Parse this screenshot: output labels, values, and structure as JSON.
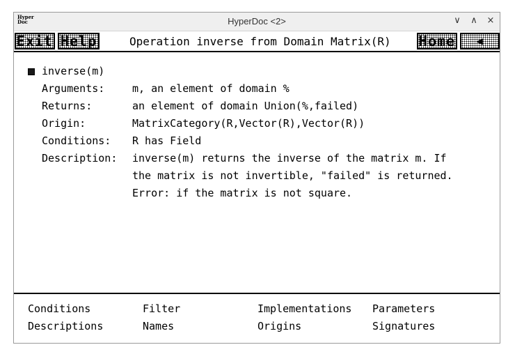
{
  "window": {
    "title": "HyperDoc <2>",
    "logo_line1": "Hyper",
    "logo_line2": "Doc",
    "controls": {
      "minimize": "∨",
      "maximize": "∧",
      "close": "×"
    }
  },
  "toolbar": {
    "exit_label": "Exit",
    "help_label": "Help",
    "page_title": "Operation inverse from Domain Matrix(R)",
    "home_label": "Home",
    "back_label": "◀"
  },
  "operation": {
    "signature": "inverse(m)",
    "fields": [
      {
        "label": "Arguments:",
        "value": "m, an element of domain %"
      },
      {
        "label": "Returns:",
        "value": "an element of domain Union(%,failed)"
      },
      {
        "label": "Origin:",
        "value": "MatrixCategory(R,Vector(R),Vector(R))"
      },
      {
        "label": "Conditions:",
        "value": "R has Field"
      },
      {
        "label": "Description:",
        "value": "inverse(m) returns the inverse of the matrix m. If"
      }
    ],
    "description_cont": [
      "the matrix is not invertible, \"failed\" is returned.",
      "Error: if the matrix is not square."
    ]
  },
  "nav_links": {
    "conditions": "Conditions",
    "filter": "Filter",
    "implementations": "Implementations",
    "parameters": "Parameters",
    "descriptions": "Descriptions",
    "names": "Names",
    "origins": "Origins",
    "signatures": "Signatures"
  }
}
